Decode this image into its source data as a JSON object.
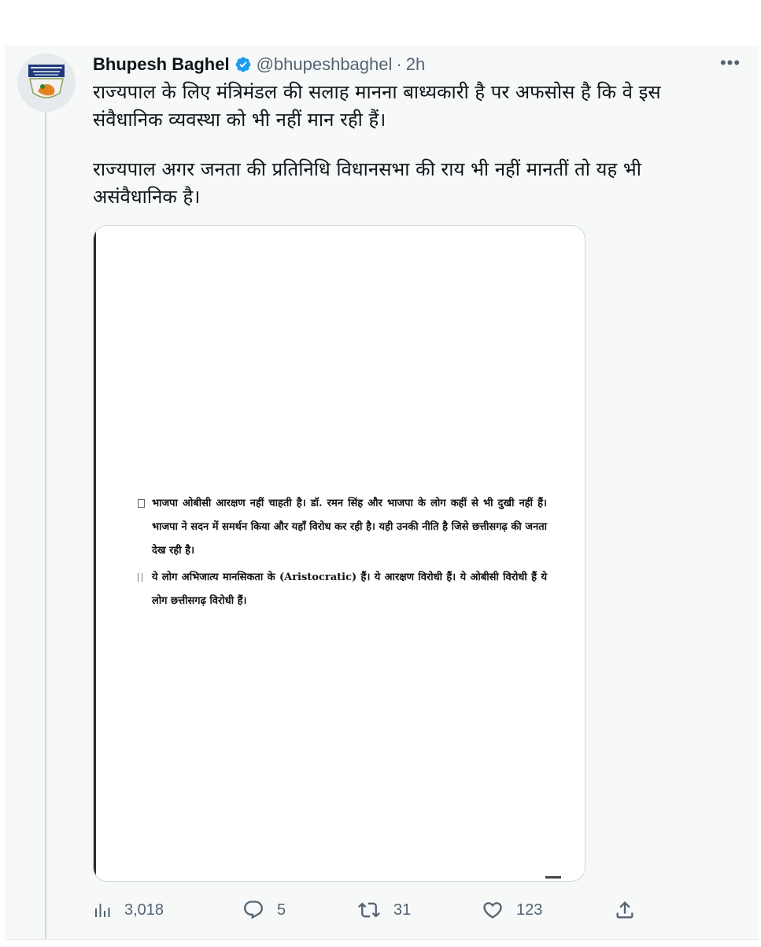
{
  "tweet": {
    "author_name": "Bhupesh Baghel",
    "handle": "@bhupeshbaghel",
    "separator": "·",
    "time": "2h",
    "more_label": "•••",
    "paragraphs": [
      "राज्यपाल के लिए मंत्रिमंडल की सलाह मानना बाध्यकारी है पर अफसोस है कि वे इस संवैधानिक व्यवस्था को भी नहीं मान रही हैं।",
      "राज्यपाल अगर जनता की प्रतिनिधि विधानसभा की राय भी नहीं मानतीं तो यह भी असंवैधानिक है।"
    ],
    "document": {
      "items": [
        "भाजपा ओबीसी आरक्षण नहीं चाहती है। डॉ. रमन सिंह और भाजपा के लोग कहीं से भी दुखी नहीं हैं। भाजपा ने सदन में समर्थन किया और यहाँ विरोध कर रही है। यही उनकी नीति है जिसे छत्तीसगढ़ की जनता देख रही है।",
        "ये लोग अभिजात्य मानसिकता के (Aristocratic) हैं। ये आरक्षण विरोधी हैं। ये ओबीसी विरोधी हैं ये लोग छत्तीसगढ़ विरोधी हैं।"
      ]
    },
    "actions": {
      "views": "3,018",
      "replies": "5",
      "retweets": "31",
      "likes": "123"
    },
    "icons": {
      "verified": "verified-badge-icon",
      "views": "analytics-icon",
      "reply": "reply-icon",
      "retweet": "retweet-icon",
      "like": "heart-icon",
      "share": "share-icon"
    },
    "colors": {
      "verified": "#1d9bf0",
      "secondary_text": "#536471",
      "background": "#f7f9f9"
    }
  }
}
